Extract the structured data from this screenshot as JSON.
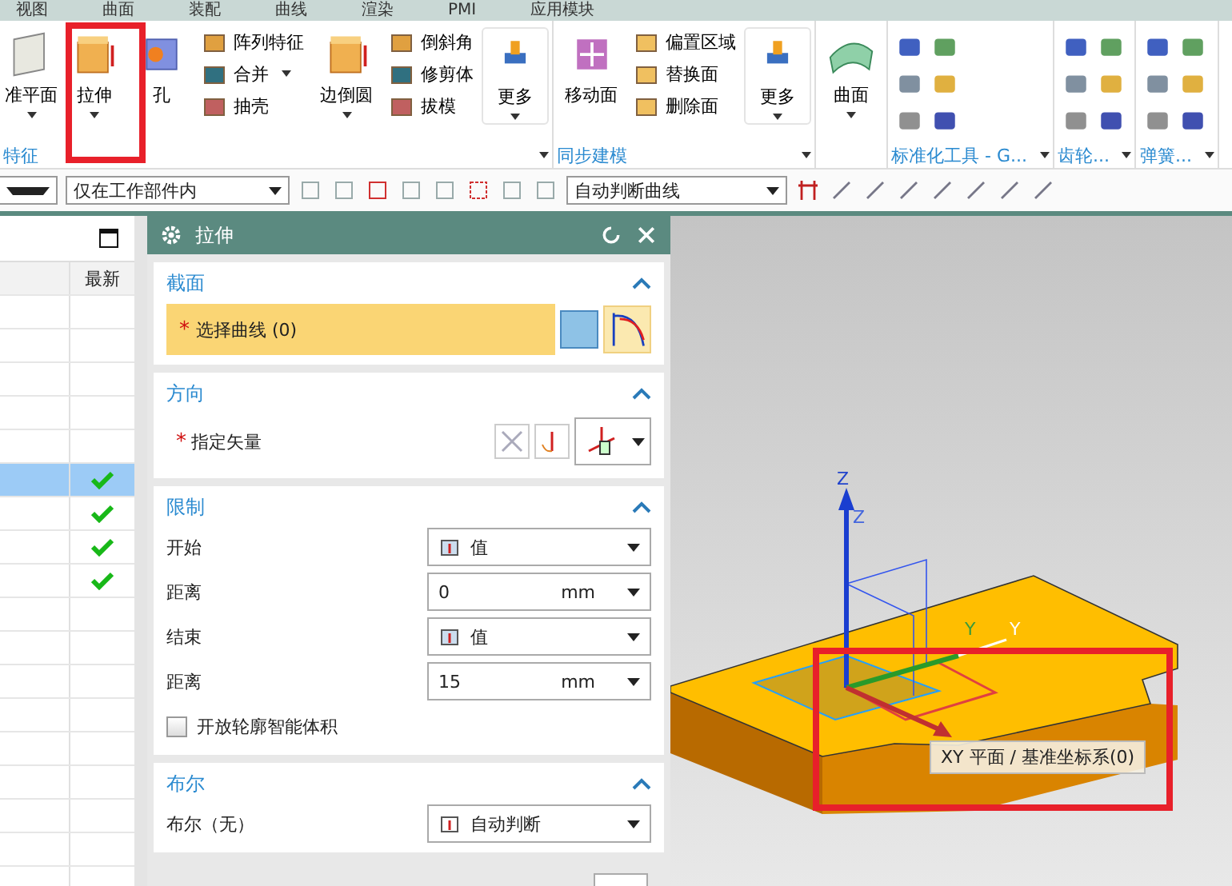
{
  "menu_tabs": [
    {
      "label": "视图"
    },
    {
      "label": "曲面"
    },
    {
      "label": "装配"
    },
    {
      "label": "曲线"
    },
    {
      "label": "渲染"
    },
    {
      "label": "PMI"
    },
    {
      "label": "应用模块"
    }
  ],
  "ribbon": {
    "groups": [
      {
        "label": "特征",
        "menu": true,
        "items": [
          {
            "kind": "large",
            "label": "准平面",
            "dropdown": true
          },
          {
            "kind": "large",
            "label": "拉伸",
            "dropdown": true
          },
          {
            "kind": "large",
            "label": "孔",
            "dropdown": false
          },
          {
            "kind": "stack",
            "items": [
              {
                "label": "阵列特征",
                "dropdown": false
              },
              {
                "label": "合并",
                "dropdown": true
              },
              {
                "label": "抽壳",
                "dropdown": false
              }
            ]
          },
          {
            "kind": "large",
            "label": "边倒圆",
            "dropdown": true
          },
          {
            "kind": "stack",
            "items": [
              {
                "label": "倒斜角",
                "dropdown": false
              },
              {
                "label": "修剪体",
                "dropdown": false
              },
              {
                "label": "拔模",
                "dropdown": false
              }
            ]
          },
          {
            "kind": "more",
            "label": "更多",
            "dropdown": true
          }
        ]
      },
      {
        "label": "同步建模",
        "menu": true,
        "items": [
          {
            "kind": "large",
            "label": "移动面",
            "dropdown": false
          },
          {
            "kind": "stack",
            "items": [
              {
                "label": "偏置区域",
                "dropdown": false
              },
              {
                "label": "替换面",
                "dropdown": false
              },
              {
                "label": "删除面",
                "dropdown": false
              }
            ]
          },
          {
            "kind": "more",
            "label": "更多",
            "dropdown": true
          }
        ]
      },
      {
        "items": [
          {
            "kind": "large",
            "label": "曲面",
            "dropdown": true
          }
        ]
      },
      {
        "label": "标准化工具 - G...",
        "menu": true,
        "items": [
          {
            "kind": "icons"
          }
        ]
      },
      {
        "label": "齿轮...",
        "menu": true,
        "items": [
          {
            "kind": "icons"
          }
        ]
      },
      {
        "label": "弹簧...",
        "menu": true,
        "items": [
          {
            "kind": "icons"
          }
        ]
      }
    ]
  },
  "toolbar": {
    "selection_filter": "仅在工作部件内",
    "curve_rule": "自动判断曲线"
  },
  "part_navigator": {
    "columns": [
      {
        "label": "最新"
      }
    ],
    "rows": [
      {
        "selected": false,
        "latest": false
      },
      {
        "selected": false,
        "latest": false
      },
      {
        "selected": false,
        "latest": false
      },
      {
        "selected": false,
        "latest": false
      },
      {
        "selected": false,
        "latest": false
      },
      {
        "selected": true,
        "latest": true
      },
      {
        "selected": false,
        "latest": true
      },
      {
        "selected": false,
        "latest": true
      },
      {
        "selected": false,
        "latest": true
      },
      {
        "selected": false,
        "latest": false
      },
      {
        "selected": false,
        "latest": false
      },
      {
        "selected": false,
        "latest": false
      },
      {
        "selected": false,
        "latest": false
      },
      {
        "selected": false,
        "latest": false
      },
      {
        "selected": false,
        "latest": false
      },
      {
        "selected": false,
        "latest": false
      },
      {
        "selected": false,
        "latest": false
      },
      {
        "selected": false,
        "latest": false
      }
    ]
  },
  "dialog": {
    "title": "拉伸",
    "sections": [
      {
        "title": "截面",
        "expanded": true,
        "rows": [
          {
            "kind": "select",
            "label": "选择曲线 (0)",
            "required_mark": "*",
            "active": true
          }
        ]
      },
      {
        "title": "方向",
        "expanded": true,
        "rows": [
          {
            "kind": "vector",
            "label": "指定矢量",
            "required_mark": "*"
          }
        ]
      },
      {
        "title": "限制",
        "expanded": true,
        "rows": [
          {
            "kind": "dropdown",
            "label": "开始",
            "value": "值"
          },
          {
            "kind": "value",
            "label": "距离",
            "value": "0",
            "unit": "mm"
          },
          {
            "kind": "dropdown",
            "label": "结束",
            "value": "值"
          },
          {
            "kind": "value",
            "label": "距离",
            "value": "15",
            "unit": "mm"
          },
          {
            "kind": "checkbox",
            "label": "开放轮廓智能体积",
            "checked": false
          }
        ]
      },
      {
        "title": "布尔",
        "expanded": true,
        "rows": [
          {
            "kind": "bool",
            "label": "布尔（无）",
            "value": "自动判断"
          }
        ]
      }
    ]
  },
  "viewport": {
    "axis_labels": [
      "Z",
      "Z",
      "Y",
      "Y"
    ],
    "tooltip": "XY 平面 / 基准坐标系(0)"
  }
}
